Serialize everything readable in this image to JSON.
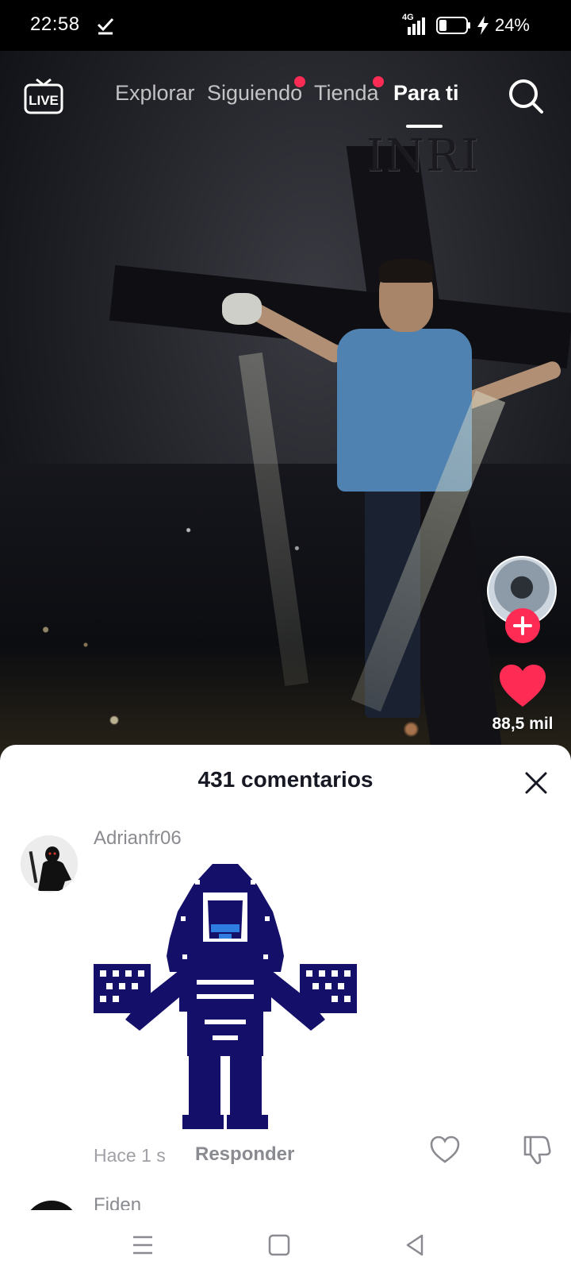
{
  "status_bar": {
    "time": "22:58",
    "network": "4G",
    "battery": "24%"
  },
  "nav": {
    "live_label": "LIVE",
    "tabs": [
      {
        "label": "Explorar",
        "active": false,
        "notification_dot": false
      },
      {
        "label": "Siguiendo",
        "active": false,
        "notification_dot": true
      },
      {
        "label": "Tienda",
        "active": false,
        "notification_dot": true
      },
      {
        "label": "Para ti",
        "active": true,
        "notification_dot": false
      }
    ]
  },
  "video": {
    "overlay_text": "INRI"
  },
  "right_rail": {
    "like_count": "88,5 mil"
  },
  "comments": {
    "title": "431 comentarios",
    "items": [
      {
        "username": "Adrianfr06",
        "time": "Hace 1 s",
        "reply_label": "Responder"
      },
      {
        "username": "Fiden"
      }
    ]
  },
  "colors": {
    "accent": "#fe2c55",
    "sticker": "#14106a",
    "sticker_eyes": "#2f7de0"
  }
}
